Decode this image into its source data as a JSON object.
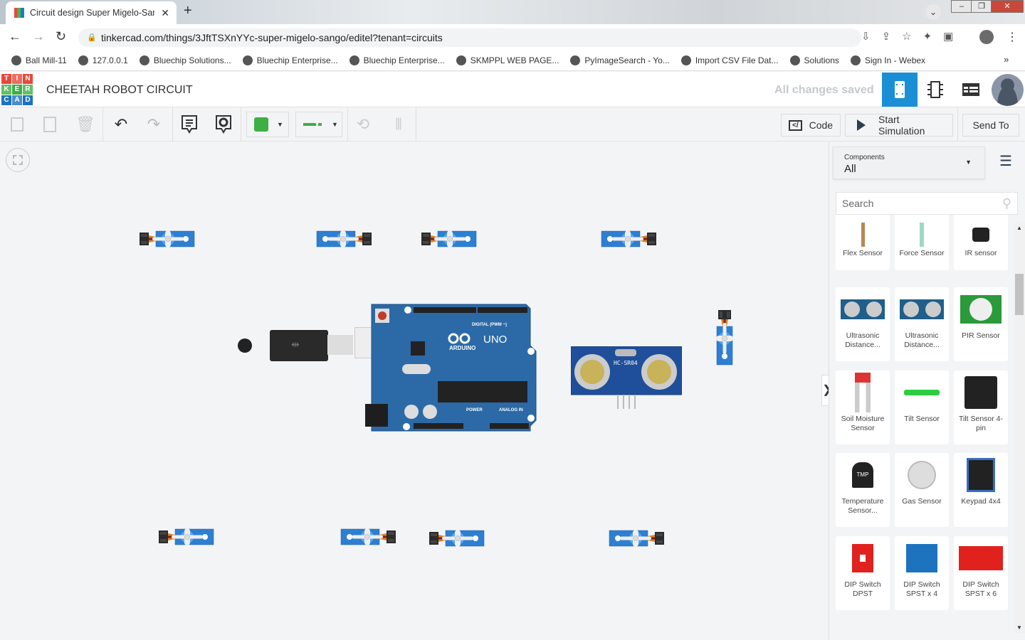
{
  "browser": {
    "tab_title": "Circuit design Super Migelo-Sang",
    "url": "tinkercad.com/things/3JftTSXnYYc-super-migelo-sango/editel?tenant=circuits",
    "bookmarks": [
      "Ball Mill-11",
      "127.0.0.1",
      "Bluechip Solutions...",
      "Bluechip Enterprise...",
      "Bluechip Enterprise...",
      "SKMPPL WEB PAGE...",
      "PyImageSearch - Yo...",
      "Import CSV File Dat...",
      "Solutions",
      "Sign In - Webex"
    ]
  },
  "app": {
    "logo": [
      "T",
      "I",
      "N",
      "K",
      "E",
      "R",
      "C",
      "A",
      "D"
    ],
    "title": "CHEETAH ROBOT CIRCUIT",
    "status": "All changes saved",
    "accent": "#1a8fd6"
  },
  "toolbar": {
    "code": "Code",
    "start_simulation": "Start Simulation",
    "send_to": "Send To",
    "wire_color": "#3cb043"
  },
  "canvas": {
    "arduino_label": "UNO",
    "arduino_brand": "ARDUINO",
    "arduino_digital": "DIGITAL (PWM ~)",
    "arduino_power": "POWER",
    "arduino_analog": "ANALOG IN",
    "sensor_label": "HC-SR04"
  },
  "panel": {
    "components_label": "Components",
    "components_value": "All",
    "search_placeholder": "Search",
    "items": [
      {
        "label": "Flex Sensor",
        "icon": "flex-sensor"
      },
      {
        "label": "Force Sensor",
        "icon": "force-sensor"
      },
      {
        "label": "IR sensor",
        "icon": "ir-sensor"
      },
      {
        "label": "Ultrasonic Distance...",
        "icon": "ultrasonic"
      },
      {
        "label": "Ultrasonic Distance...",
        "icon": "ultrasonic"
      },
      {
        "label": "PIR Sensor",
        "icon": "pir"
      },
      {
        "label": "Soil Moisture Sensor",
        "icon": "soil"
      },
      {
        "label": "Tilt Sensor",
        "icon": "tilt"
      },
      {
        "label": "Tilt Sensor 4-pin",
        "icon": "tilt4"
      },
      {
        "label": "Temperature Sensor...",
        "icon": "tmp"
      },
      {
        "label": "Gas Sensor",
        "icon": "gas"
      },
      {
        "label": "Keypad 4x4",
        "icon": "keypad"
      },
      {
        "label": "DIP Switch DPST",
        "icon": "dip-dpst"
      },
      {
        "label": "DIP Switch SPST x 4",
        "icon": "dip4"
      },
      {
        "label": "DIP Switch SPST x 6",
        "icon": "dip6"
      }
    ]
  }
}
